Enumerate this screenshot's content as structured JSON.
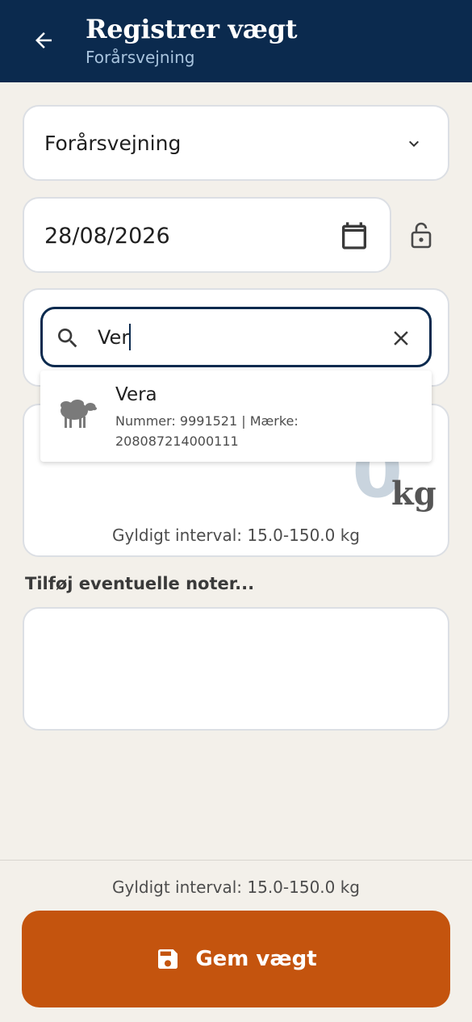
{
  "header": {
    "title": "Registrer vægt",
    "subtitle": "Forårsvejning"
  },
  "weighing_type": {
    "selected": "Forårsvejning"
  },
  "date": {
    "value": "28/08/2026"
  },
  "search": {
    "value": "Ver"
  },
  "search_result": {
    "name": "Vera",
    "detail": "Nummer: 9991521 | Mærke: 208087214000111"
  },
  "weight": {
    "value": "0",
    "unit": "kg",
    "interval": "Gyldigt interval: 15.0-150.0 kg"
  },
  "notes": {
    "label": "Tilføj eventuelle noter..."
  },
  "footer": {
    "interval": "Gyldigt interval: 15.0-150.0 kg",
    "save_label": "Gem vægt"
  },
  "icons": {
    "back": "arrow-left-icon",
    "dropdown": "chevron-down-icon",
    "calendar": "calendar-icon",
    "lock": "lock-open-icon",
    "search": "search-icon",
    "clear": "close-icon",
    "sheep": "sheep-icon",
    "save": "save-icon"
  },
  "colors": {
    "appbar": "#0b2a4e",
    "accent": "#c4540e",
    "background": "#f3f0ea"
  }
}
